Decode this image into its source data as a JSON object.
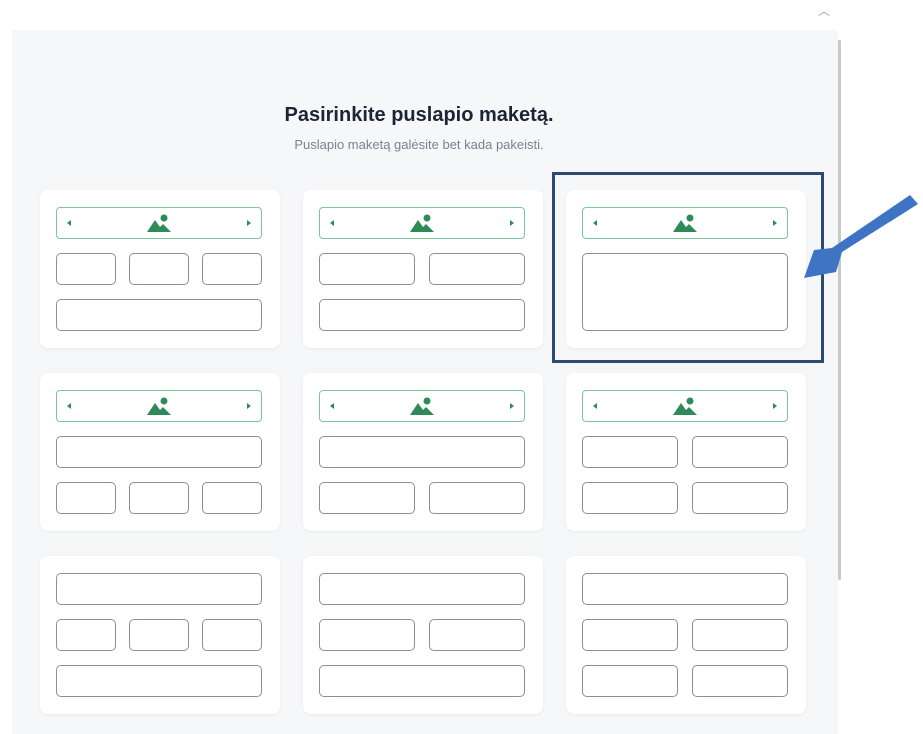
{
  "header": {
    "title": "Pasirinkite puslapio maketą.",
    "subtitle": "Puslapio maketą galėsite bet kada pakeisti."
  },
  "layouts": [
    {
      "id": "layout-1",
      "rows": [
        "slider",
        "3",
        "wide"
      ]
    },
    {
      "id": "layout-2",
      "rows": [
        "slider",
        "2",
        "wide"
      ]
    },
    {
      "id": "layout-3",
      "rows": [
        "slider",
        "big"
      ],
      "highlighted": true
    },
    {
      "id": "layout-4",
      "rows": [
        "slider",
        "wide",
        "3"
      ]
    },
    {
      "id": "layout-5",
      "rows": [
        "slider",
        "wide",
        "2"
      ]
    },
    {
      "id": "layout-6",
      "rows": [
        "slider",
        "2",
        "2"
      ]
    },
    {
      "id": "layout-7",
      "rows": [
        "wide",
        "3",
        "wide"
      ]
    },
    {
      "id": "layout-8",
      "rows": [
        "wide",
        "2",
        "wide"
      ]
    },
    {
      "id": "layout-9",
      "rows": [
        "wide",
        "2",
        "2"
      ]
    }
  ],
  "colors": {
    "accent_green": "#2e8b57",
    "highlight_border": "#2d4a6f",
    "annotation_arrow": "#3f74c4"
  },
  "icons": [
    "image-icon",
    "arrow-left-icon",
    "arrow-right-icon",
    "chevron-up-icon"
  ]
}
